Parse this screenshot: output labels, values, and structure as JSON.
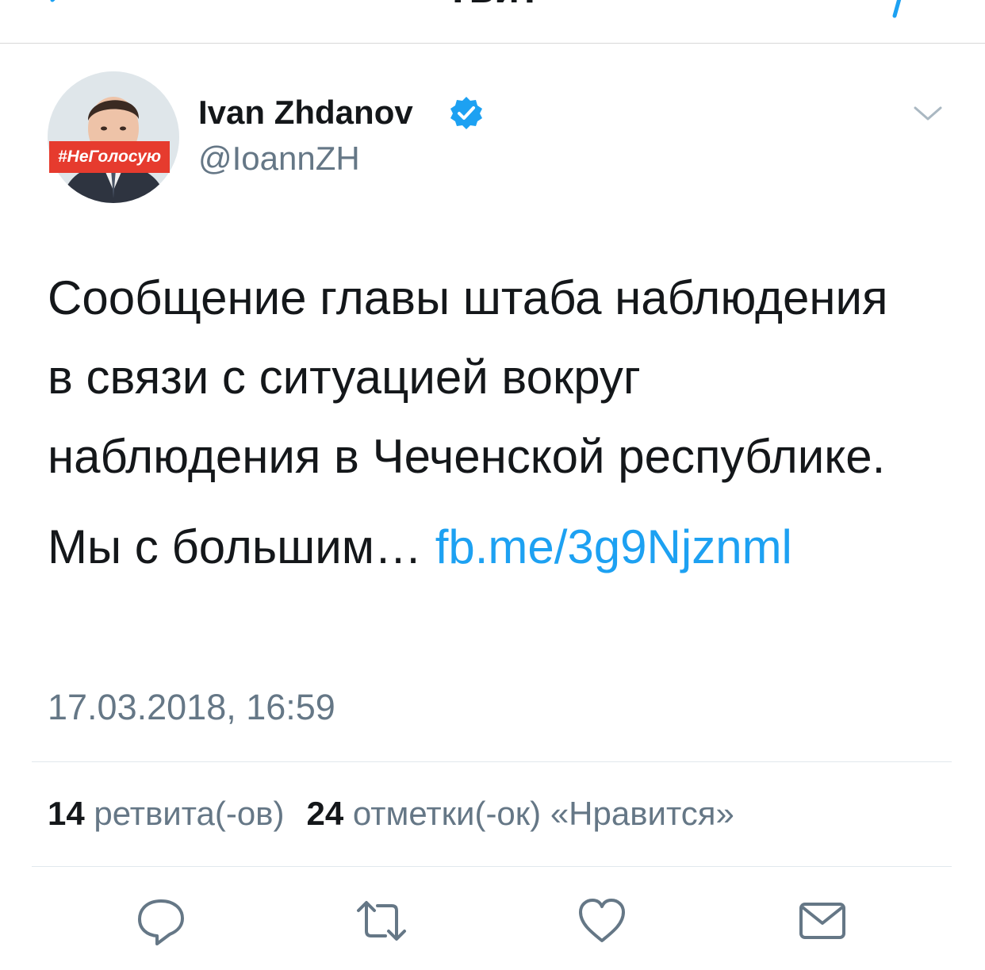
{
  "nav": {
    "title": "Твит",
    "back_icon": "chevron-left-icon",
    "compose_icon": "compose-icon"
  },
  "author": {
    "display_name": "Ivan Zhdanov",
    "handle": "@IoannZH",
    "verified": true,
    "avatar_badge": "#НеГолосую"
  },
  "tweet": {
    "text": "Сообщение главы штаба наблюдения в связи с ситуацией вокруг наблюдения в Чеченской республике.",
    "text2": "Мы с большим…",
    "link": "fb.me/3g9Njznml",
    "timestamp": "17.03.2018, 16:59"
  },
  "stats": {
    "retweets_count": "14",
    "retweets_label": "ретвита(-ов)",
    "likes_count": "24",
    "likes_label": "отметки(-ок) «Нравится»"
  },
  "actions": [
    {
      "icon": "reply-icon"
    },
    {
      "icon": "retweet-icon"
    },
    {
      "icon": "like-icon"
    },
    {
      "icon": "share-icon"
    }
  ],
  "colors": {
    "link": "#1da1f2",
    "verified": "#1da1f2",
    "secondary_text": "#657786",
    "badge": "#e63b2e"
  }
}
